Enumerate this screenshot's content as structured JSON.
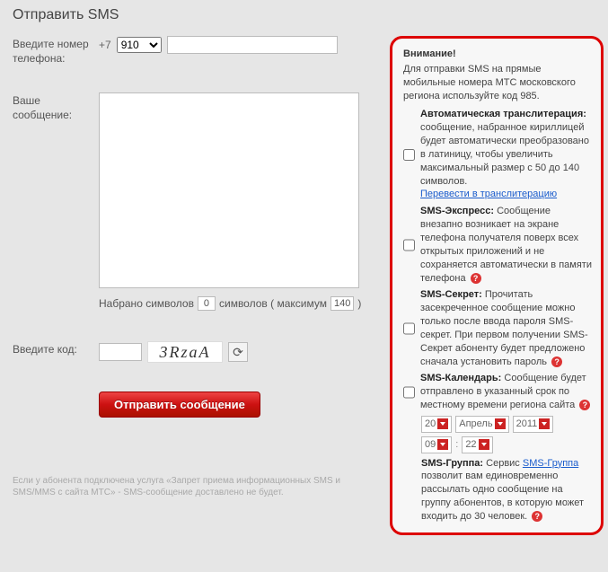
{
  "title": "Отправить SMS",
  "phone": {
    "label": "Введите номер телефона:",
    "prefix": "+7",
    "code_selected": "910",
    "number_value": ""
  },
  "message": {
    "label": "Ваше сообщение:",
    "value": "",
    "typed_label": "Набрано символов",
    "typed_count": "0",
    "max_label_prefix": "символов ( максимум",
    "max_count": "140",
    "max_label_suffix": ")"
  },
  "captcha": {
    "label": "Введите код:",
    "value": "",
    "image_text": "3RzaA"
  },
  "submit_label": "Отправить сообщение",
  "footnote": "Если у абонента подключена услуга «Запрет приема информационных SMS и SMS/MMS с сайта МТС» - SMS-сообщение доставлено не будет.",
  "info": {
    "warning_title": "Внимание!",
    "intro": "Для отправки SMS на прямые мобильные номера МТС московского региона используйте код 985.",
    "opt_translit": {
      "title": "Автоматическая транслитерация:",
      "text": "сообщение, набранное кириллицей будет автоматически преобразовано в латиницу, чтобы увеличить максимальный размер с 50 до 140 символов.",
      "link": "Перевести в транслитерацию"
    },
    "opt_express": {
      "title": "SMS-Экспресс:",
      "text": "Сообщение внезапно возникает на экране телефона получателя поверх всех открытых приложений и не сохраняется автоматически в памяти телефона"
    },
    "opt_secret": {
      "title": "SMS-Секрет:",
      "text": "Прочитать засекреченное сообщение можно только после ввода пароля SMS-секрет. При первом получении SMS-Секрет абоненту будет предложено сначала установить пароль"
    },
    "opt_calendar": {
      "title": "SMS-Календарь:",
      "text": "Сообщение будет отправлено в указанный срок по местному времени региона сайта",
      "day": "20",
      "month": "Апрель",
      "year": "2011",
      "hour": "09",
      "minute": "22"
    },
    "group": {
      "title": "SMS-Группа:",
      "link_text": "SMS-Группа",
      "pre_text": "Сервис ",
      "post_text": " позволит вам единовременно рассылать одно сообщение на группу абонентов, в которую может входить до 30 человек."
    }
  }
}
